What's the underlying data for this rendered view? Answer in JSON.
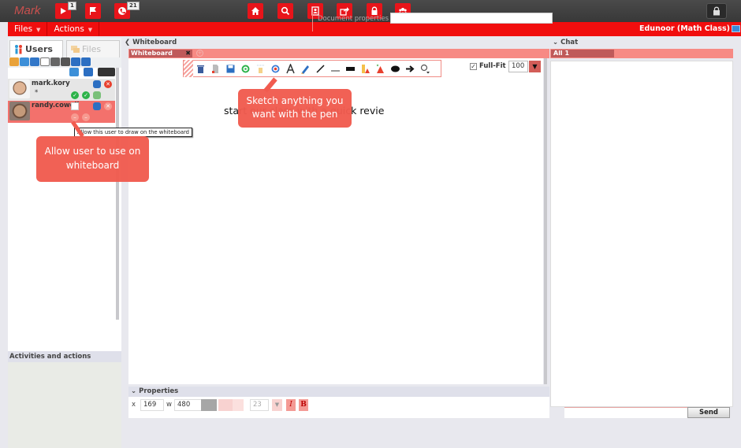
{
  "topbar": {
    "user_name": "Mark",
    "left_buttons": [
      {
        "icon": "play-icon",
        "badge": "1"
      },
      {
        "icon": "flag-icon",
        "badge": ""
      },
      {
        "icon": "phone-icon",
        "badge": "21"
      }
    ],
    "center_buttons": [
      {
        "icon": "home-icon"
      },
      {
        "icon": "search-icon"
      },
      {
        "icon": "contact-book-icon"
      },
      {
        "icon": "share-icon"
      },
      {
        "icon": "lock-icon"
      },
      {
        "icon": "users-group-icon"
      }
    ],
    "right_button": {
      "icon": "lock-icon"
    }
  },
  "menubar": {
    "menus": [
      {
        "label": "Files",
        "caret": "▼"
      },
      {
        "label": "Actions",
        "caret": "▼"
      }
    ],
    "room_title": "Edunoor (Math Class)"
  },
  "left_panel": {
    "tabs": [
      {
        "label": "Users",
        "active": true
      },
      {
        "label": "Files",
        "active": false
      }
    ],
    "users": [
      {
        "name": "mark.kory",
        "status": "*",
        "whiteboard_allowed": true,
        "screen_allowed": true
      },
      {
        "name": "randy.cowell",
        "status": "",
        "whiteboard_allowed": false,
        "screen_allowed": false
      }
    ],
    "tooltip": "Allow this user to draw on the whiteboard",
    "activities_title": "Activities and actions"
  },
  "callouts": {
    "users_callout": "Allow user to use on whiteboard",
    "pen_callout": "Sketch anything you want with the pen"
  },
  "whiteboard": {
    "panel_title": "Whiteboard",
    "tabs": [
      {
        "label": "Whiteboard",
        "close": "✖"
      }
    ],
    "add_tab": "+",
    "tools": [
      "trash-icon",
      "clear-page-icon",
      "save-icon",
      "undo-icon",
      "pointer-icon",
      "target-icon",
      "text-icon",
      "pen-icon",
      "line-icon",
      "underline-icon",
      "rectangle-icon",
      "triangle-icon",
      "clipart-icon",
      "ellipse-icon",
      "arrow-icon",
      "zoom-select-icon"
    ],
    "full_fit_label": "Full-Fit",
    "full_fit_checked": true,
    "zoom_value": "100",
    "canvas_text": "start our class with a quick revie"
  },
  "properties": {
    "title": "Properties",
    "x_label": "x",
    "x_value": "169",
    "w_label": "w",
    "w_value": "480",
    "font_size": "23",
    "italic_label": "I",
    "bold_label": "B",
    "document_properties_label": "Document properties",
    "document_properties_value": ""
  },
  "chat": {
    "title": "Chat",
    "tabs": [
      {
        "label": "All 1"
      }
    ],
    "input_value": "",
    "send_label": "Send"
  }
}
